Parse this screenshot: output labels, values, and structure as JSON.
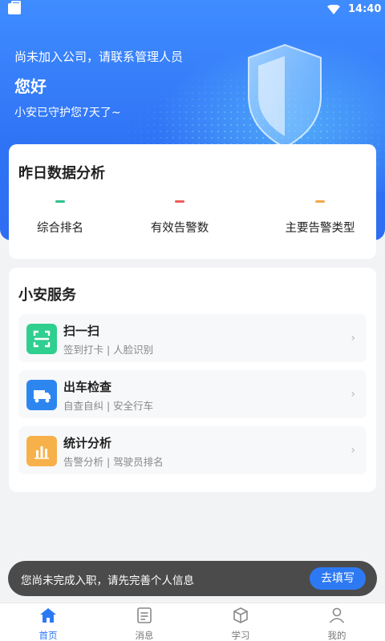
{
  "status_bar": {
    "time": "14:40"
  },
  "hero": {
    "notice": "尚未加入公司，请联系管理人员",
    "greeting": "您好",
    "guard_days": "小安已守护您7天了~"
  },
  "yesterday": {
    "title": "昨日数据分析",
    "stats": [
      {
        "label": "综合排名",
        "color": "#2ec28a"
      },
      {
        "label": "有效告警数",
        "color": "#f05b5b"
      },
      {
        "label": "主要告警类型",
        "color": "#f5a847"
      }
    ]
  },
  "services": {
    "title": "小安服务",
    "items": [
      {
        "title": "扫一扫",
        "subtitle": "签到打卡 | 人脸识别",
        "icon": "scan-icon",
        "color": "#2fcf8f"
      },
      {
        "title": "出车检查",
        "subtitle": "自查自纠 | 安全行车",
        "icon": "truck-icon",
        "color": "#2d86f0"
      },
      {
        "title": "统计分析",
        "subtitle": "告警分析 | 驾驶员排名",
        "icon": "bar-chart-icon",
        "color": "#f7b14a"
      }
    ]
  },
  "toast": {
    "message": "您尚未完成入职，请先完善个人信息",
    "button": "去填写"
  },
  "tabs": [
    {
      "label": "首页",
      "icon": "home-icon",
      "active": true
    },
    {
      "label": "消息",
      "icon": "message-icon",
      "active": false
    },
    {
      "label": "学习",
      "icon": "learning-icon",
      "active": false
    },
    {
      "label": "我的",
      "icon": "profile-icon",
      "active": false
    }
  ],
  "colors": {
    "primary": "#2d79f3",
    "header": "#3f8cff"
  }
}
